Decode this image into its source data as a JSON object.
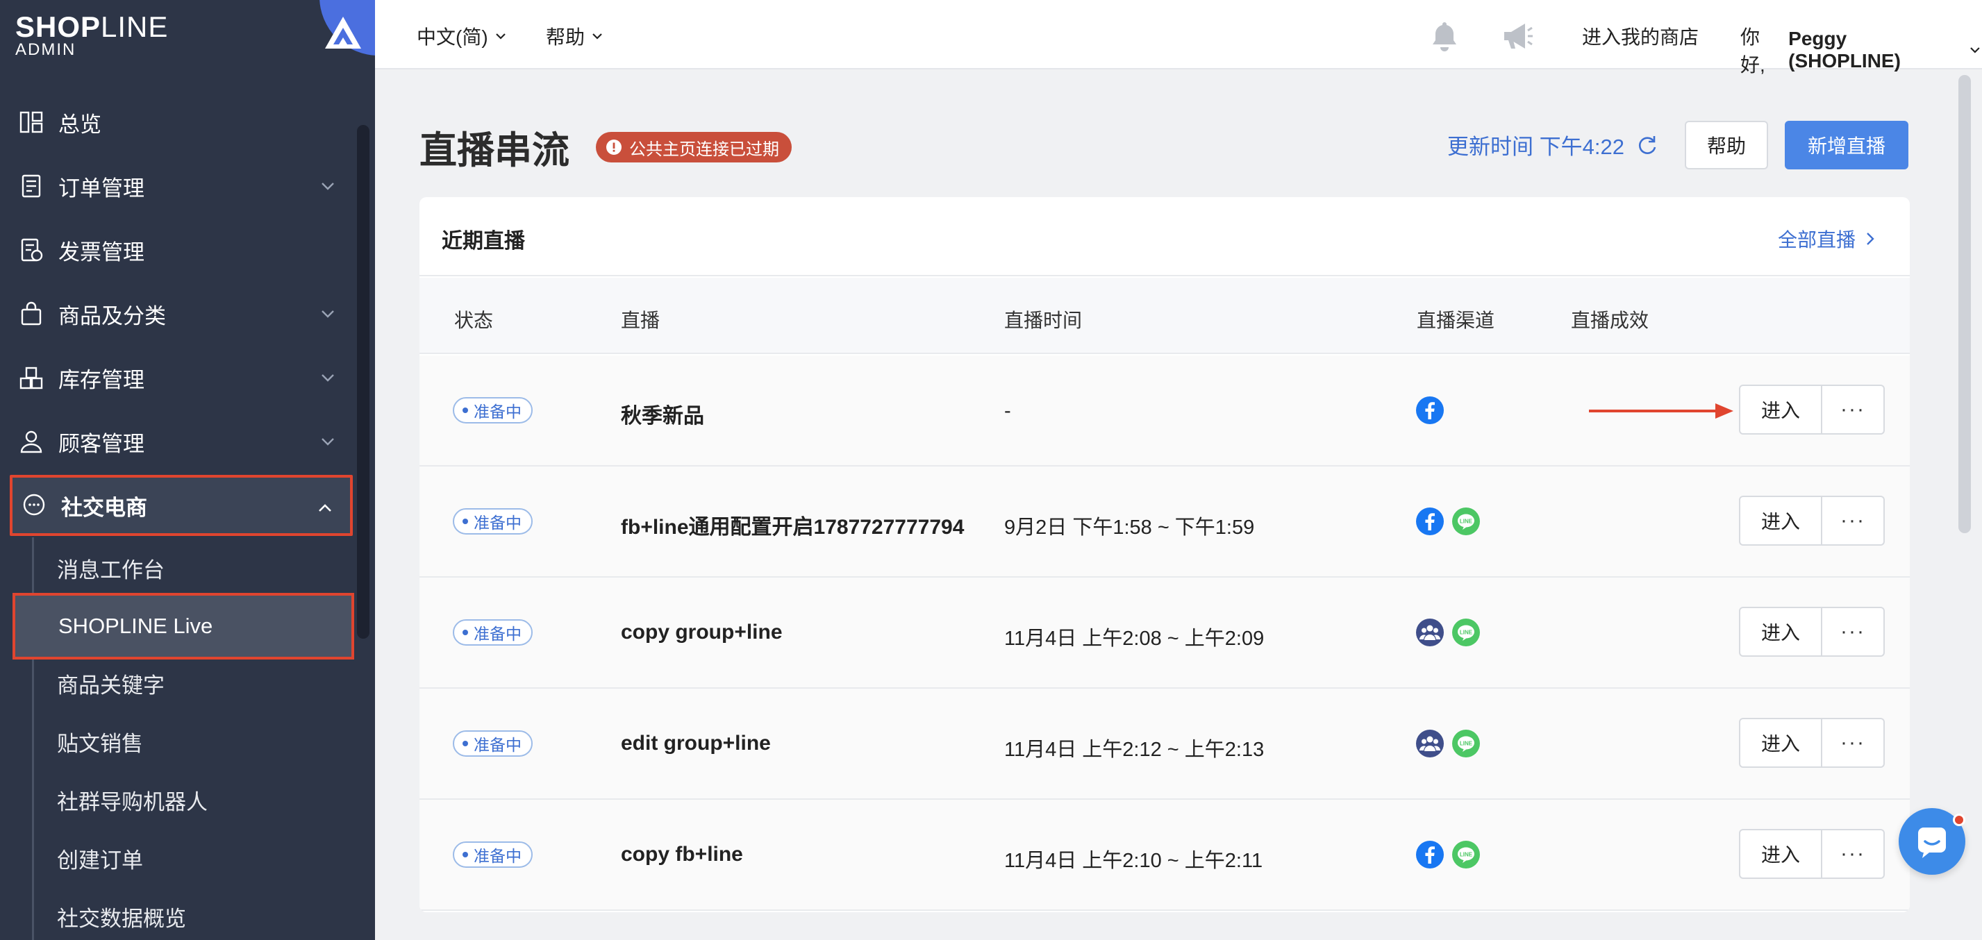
{
  "brand": {
    "word_bold": "SHOP",
    "word_thin": "LINE",
    "sub": "ADMIN"
  },
  "sidebar": {
    "items": [
      {
        "label": "总览",
        "icon": "dashboard-icon"
      },
      {
        "label": "订单管理",
        "icon": "order-icon"
      },
      {
        "label": "发票管理",
        "icon": "invoice-icon"
      },
      {
        "label": "商品及分类",
        "icon": "product-bag-icon"
      },
      {
        "label": "库存管理",
        "icon": "inventory-icon"
      },
      {
        "label": "顾客管理",
        "icon": "customer-icon"
      },
      {
        "label": "社交电商",
        "icon": "chat-bubble-icon"
      }
    ],
    "sub_items": [
      {
        "label": "消息工作台"
      },
      {
        "label": "SHOPLINE Live"
      },
      {
        "label": "商品关键字"
      },
      {
        "label": "贴文销售"
      },
      {
        "label": "社群导购机器人"
      },
      {
        "label": "创建订单"
      },
      {
        "label": "社交数据概览"
      }
    ]
  },
  "topbar": {
    "language": "中文(简)",
    "help": "帮助",
    "store_link": "进入我的商店",
    "greeting": "你好,",
    "user_name": "Peggy (SHOPLINE)"
  },
  "page": {
    "title": "直播串流",
    "warning": "公共主页连接已过期",
    "update_label": "更新时间 下午4:22",
    "help_button": "帮助",
    "new_button": "新增直播"
  },
  "card": {
    "title": "近期直播",
    "all_link": "全部直播",
    "columns": {
      "status": "状态",
      "live": "直播",
      "time": "直播时间",
      "channel": "直播渠道",
      "performance": "直播成效"
    },
    "rows": [
      {
        "status": "准备中",
        "name": "秋季新品",
        "time": "-",
        "channels": [
          "facebook-icon"
        ],
        "enter": "进入",
        "more": "···"
      },
      {
        "status": "准备中",
        "name": "fb+line通用配置开启1787727777794",
        "time": "9月2日 下午1:58 ~ 下午1:59",
        "channels": [
          "facebook-icon",
          "line-icon"
        ],
        "enter": "进入",
        "more": "···"
      },
      {
        "status": "准备中",
        "name": "copy group+line",
        "time": "11月4日 上午2:08 ~ 上午2:09",
        "channels": [
          "group-icon",
          "line-icon"
        ],
        "enter": "进入",
        "more": "···"
      },
      {
        "status": "准备中",
        "name": "edit group+line",
        "time": "11月4日 上午2:12 ~ 上午2:13",
        "channels": [
          "group-icon",
          "line-icon"
        ],
        "enter": "进入",
        "more": "···"
      },
      {
        "status": "准备中",
        "name": "copy fb+line",
        "time": "11月4日 上午2:10 ~ 上午2:11",
        "channels": [
          "facebook-icon",
          "line-icon"
        ],
        "enter": "进入",
        "more": "···"
      }
    ]
  },
  "colors": {
    "sidebar_bg": "#2d3547",
    "accent_blue": "#3d6fd1",
    "primary_button": "#4b86e6",
    "warning_badge": "#c94f3b",
    "highlight_red": "#e0452f",
    "facebook": "#1877f2",
    "line": "#4cc764",
    "group": "#3f4e8a"
  }
}
